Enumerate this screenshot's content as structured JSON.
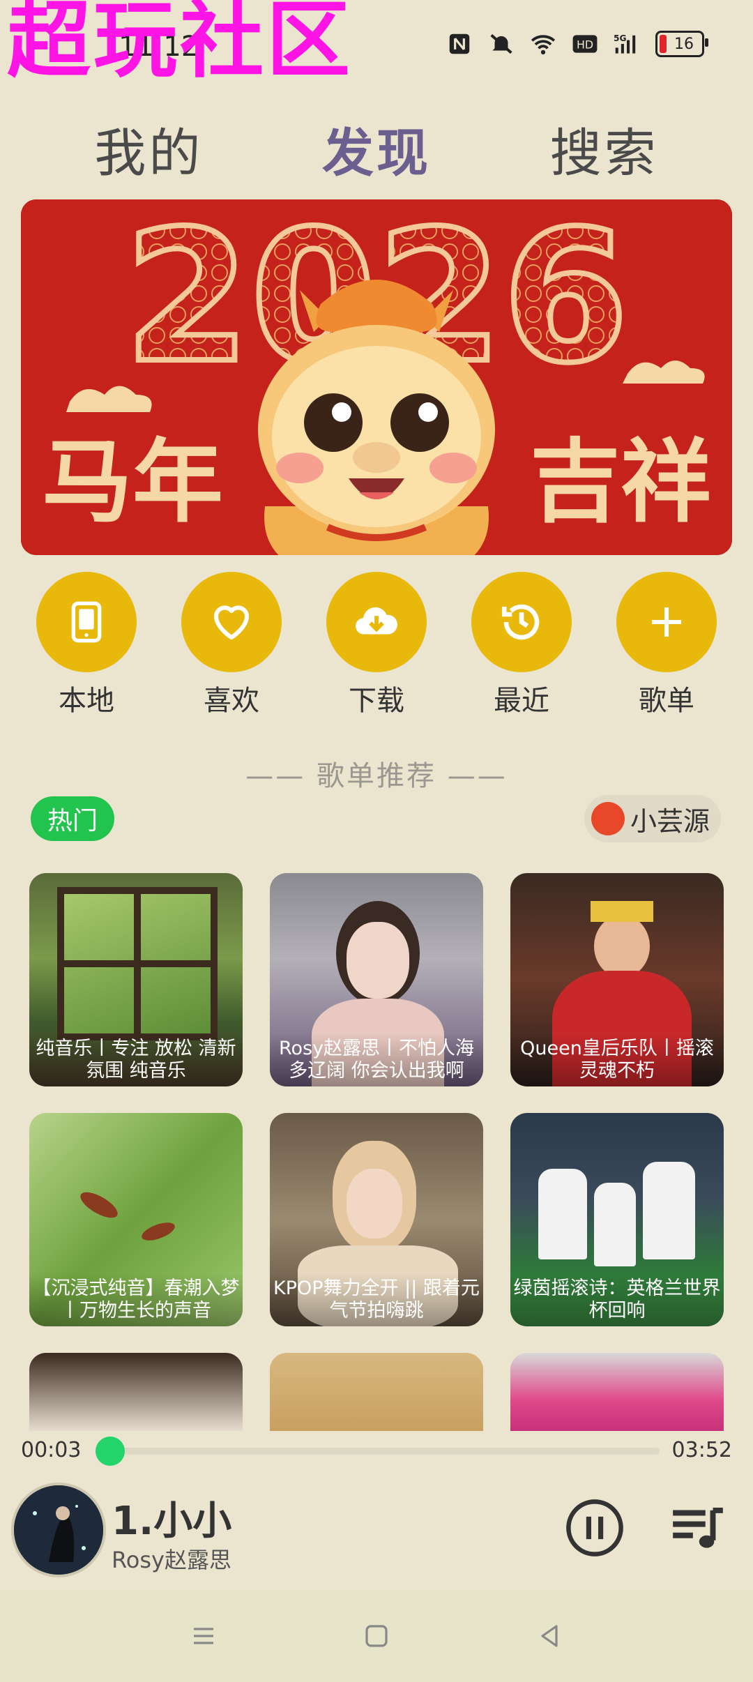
{
  "status_bar": {
    "watermark": "超玩社区",
    "time": "11:12",
    "battery": "16",
    "icons": [
      "nfc-icon",
      "bell-muted-icon",
      "wifi-icon",
      "hd-icon",
      "signal-5g-icon",
      "battery-icon"
    ]
  },
  "tabs": [
    {
      "label": "我的",
      "active": false
    },
    {
      "label": "发现",
      "active": true
    },
    {
      "label": "搜索",
      "active": false
    }
  ],
  "banner": {
    "year": "2026",
    "left_text": "马年",
    "right_text": "吉祥"
  },
  "quick_actions": [
    {
      "label": "本地",
      "icon": "phone-icon"
    },
    {
      "label": "喜欢",
      "icon": "heart-icon"
    },
    {
      "label": "下载",
      "icon": "cloud-download-icon"
    },
    {
      "label": "最近",
      "icon": "history-icon"
    },
    {
      "label": "歌单",
      "icon": "plus-icon"
    }
  ],
  "playlist_section": {
    "title": "—— 歌单推荐 ——",
    "hot_chip": "热门",
    "source_chip": "小芸源"
  },
  "playlists": [
    {
      "caption": "纯音乐丨专注 放松 清新氛围 纯音乐"
    },
    {
      "caption": "Rosy赵露思丨不怕人海多辽阔 你会认出我啊"
    },
    {
      "caption": "Queen皇后乐队丨摇滚灵魂不朽"
    },
    {
      "caption": "【沉浸式纯音】春潮入梦丨万物生长的声音"
    },
    {
      "caption": "KPOP舞力全开 || 跟着元气节拍嗨跳"
    },
    {
      "caption": "绿茵摇滚诗：英格兰世界杯回响"
    }
  ],
  "player": {
    "current_time": "00:03",
    "total_time": "03:52",
    "progress": 0.013,
    "title": "1.小小",
    "artist": "Rosy赵露思"
  },
  "colors": {
    "background": "#ebe5d0",
    "accent": "#e8b80a",
    "active_tab": "#6a5f8e",
    "hot_chip": "#22c44e",
    "progress_knob": "#22d46a"
  }
}
